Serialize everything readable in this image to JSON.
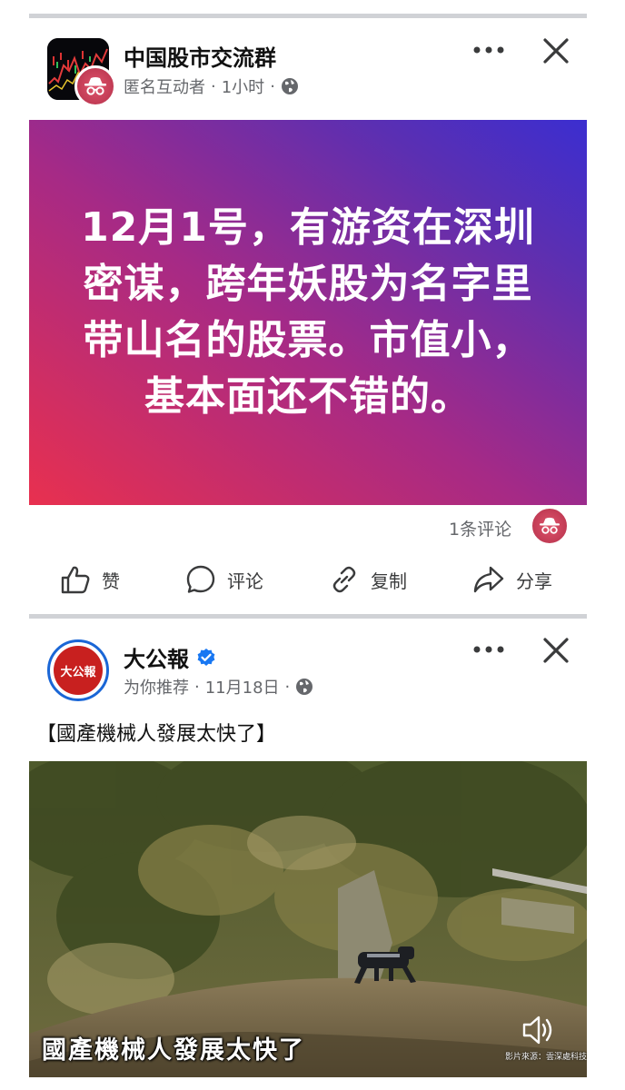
{
  "post1": {
    "group_name": "中国股市交流群",
    "author": "匿名互动者",
    "time": "1小时",
    "message": "12月1号，有游资在深圳密谋，跨年妖股为名字里带山名的股票。市值小，基本面还不错的。",
    "comment_count": "1条评论",
    "actions": {
      "like": "赞",
      "comment": "评论",
      "copy": "复制",
      "share": "分享"
    }
  },
  "post2": {
    "page_name": "大公報",
    "logo_text": "大公報",
    "recommend": "为你推荐",
    "date": "11月18日",
    "title": "【國產機械人發展太快了】",
    "video_caption": "國產機械人發展太快了",
    "video_credit": "影片來源：雲深處科技"
  },
  "colors": {
    "card_gradient_start": "#e8304f",
    "card_gradient_end": "#3b2ed0",
    "verified_blue": "#1877f2",
    "logo_red": "#c8201f"
  },
  "icons": [
    "more-icon",
    "close-icon",
    "globe-icon",
    "like-icon",
    "comment-icon",
    "link-icon",
    "share-icon",
    "verified-icon",
    "sound-icon"
  ]
}
